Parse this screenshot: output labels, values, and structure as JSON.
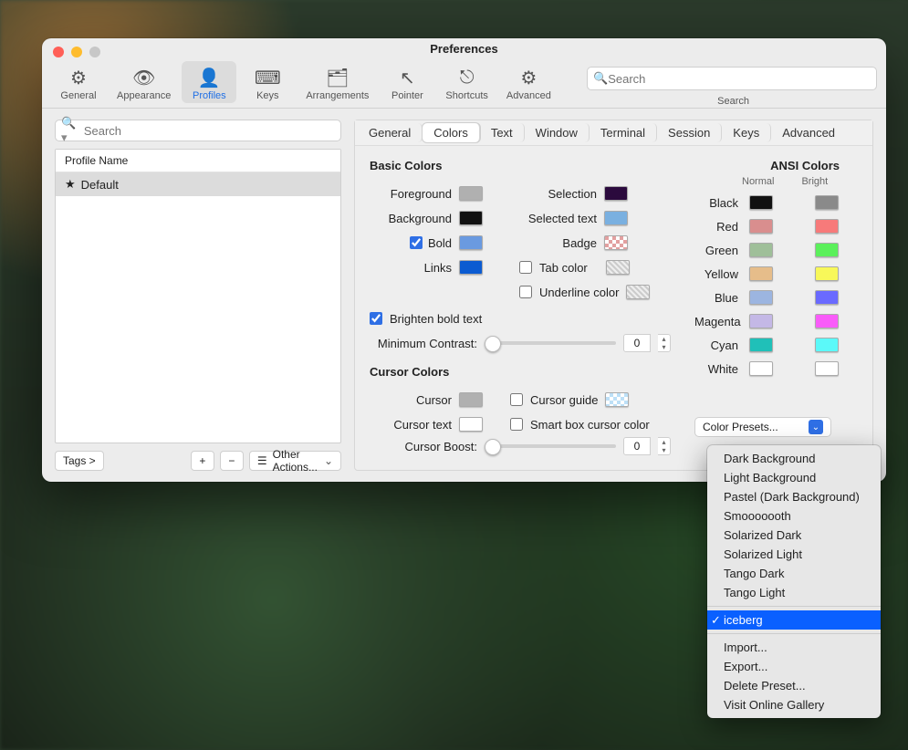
{
  "window": {
    "title": "Preferences"
  },
  "toolbar": {
    "items": [
      {
        "label": "General",
        "icon": "⚙"
      },
      {
        "label": "Appearance",
        "icon": "👁"
      },
      {
        "label": "Profiles",
        "icon": "👤",
        "selected": true
      },
      {
        "label": "Keys",
        "icon": "⌨"
      },
      {
        "label": "Arrangements",
        "icon": "🗂"
      },
      {
        "label": "Pointer",
        "icon": "↖"
      },
      {
        "label": "Shortcuts",
        "icon": "⚡"
      },
      {
        "label": "Advanced",
        "icon": "⚙⚙"
      }
    ],
    "search": {
      "placeholder": "Search",
      "label": "Search"
    }
  },
  "profiles": {
    "search_placeholder": "Search",
    "header": "Profile Name",
    "items": [
      {
        "name": "Default",
        "starred": true,
        "selected": true
      }
    ],
    "tags_label": "Tags >",
    "other_actions": "Other Actions..."
  },
  "tabs": [
    "General",
    "Colors",
    "Text",
    "Window",
    "Terminal",
    "Session",
    "Keys",
    "Advanced"
  ],
  "active_tab": "Colors",
  "basic": {
    "title": "Basic Colors",
    "foreground": {
      "label": "Foreground",
      "color": "#b0b0b0"
    },
    "background": {
      "label": "Background",
      "color": "#111111"
    },
    "bold": {
      "label": "Bold",
      "checked": true,
      "color": "#6a9ae0"
    },
    "links": {
      "label": "Links",
      "color": "#0b5bd1"
    },
    "brighten": {
      "label": "Brighten bold text",
      "checked": true
    },
    "min_contrast": {
      "label": "Minimum Contrast:",
      "value": "0"
    },
    "selection": {
      "label": "Selection",
      "color": "#2b0a3d"
    },
    "selected_text": {
      "label": "Selected text",
      "color": "#7ab0e0"
    },
    "badge": {
      "label": "Badge",
      "checker": true
    },
    "tab_color": {
      "label": "Tab color",
      "checked": false,
      "diagonal": true
    },
    "underline": {
      "label": "Underline color",
      "checked": false,
      "diagonal": true
    }
  },
  "cursor": {
    "title": "Cursor Colors",
    "cursor": {
      "label": "Cursor",
      "color": "#b0b0b0"
    },
    "cursor_text": {
      "label": "Cursor text",
      "color": "#ffffff"
    },
    "cursor_boost": {
      "label": "Cursor Boost:",
      "value": "0"
    },
    "cursor_guide": {
      "label": "Cursor guide",
      "checked": false,
      "checker": true
    },
    "smart_box": {
      "label": "Smart box cursor color",
      "checked": false
    }
  },
  "ansi": {
    "title": "ANSI Colors",
    "normal_label": "Normal",
    "bright_label": "Bright",
    "rows": [
      {
        "name": "Black",
        "normal": "#111111",
        "bright": "#8a8a8a"
      },
      {
        "name": "Red",
        "normal": "#d98e8e",
        "bright": "#f77a7a"
      },
      {
        "name": "Green",
        "normal": "#9fbf99",
        "bright": "#5bf05b"
      },
      {
        "name": "Yellow",
        "normal": "#e6bd8a",
        "bright": "#f8f859"
      },
      {
        "name": "Blue",
        "normal": "#9cb5e0",
        "bright": "#6a6aff"
      },
      {
        "name": "Magenta",
        "normal": "#c4b8e6",
        "bright": "#f95bf9"
      },
      {
        "name": "Cyan",
        "normal": "#20c0b8",
        "bright": "#5bf9f9"
      },
      {
        "name": "White",
        "normal": "#ffffff",
        "bright": "#ffffff"
      }
    ]
  },
  "presets": {
    "button": "Color Presets...",
    "items": [
      "Dark Background",
      "Light Background",
      "Pastel (Dark Background)",
      "Smooooooth",
      "Solarized Dark",
      "Solarized Light",
      "Tango Dark",
      "Tango Light"
    ],
    "selected": "iceberg",
    "actions": [
      "Import...",
      "Export...",
      "Delete Preset...",
      "Visit Online Gallery"
    ]
  }
}
